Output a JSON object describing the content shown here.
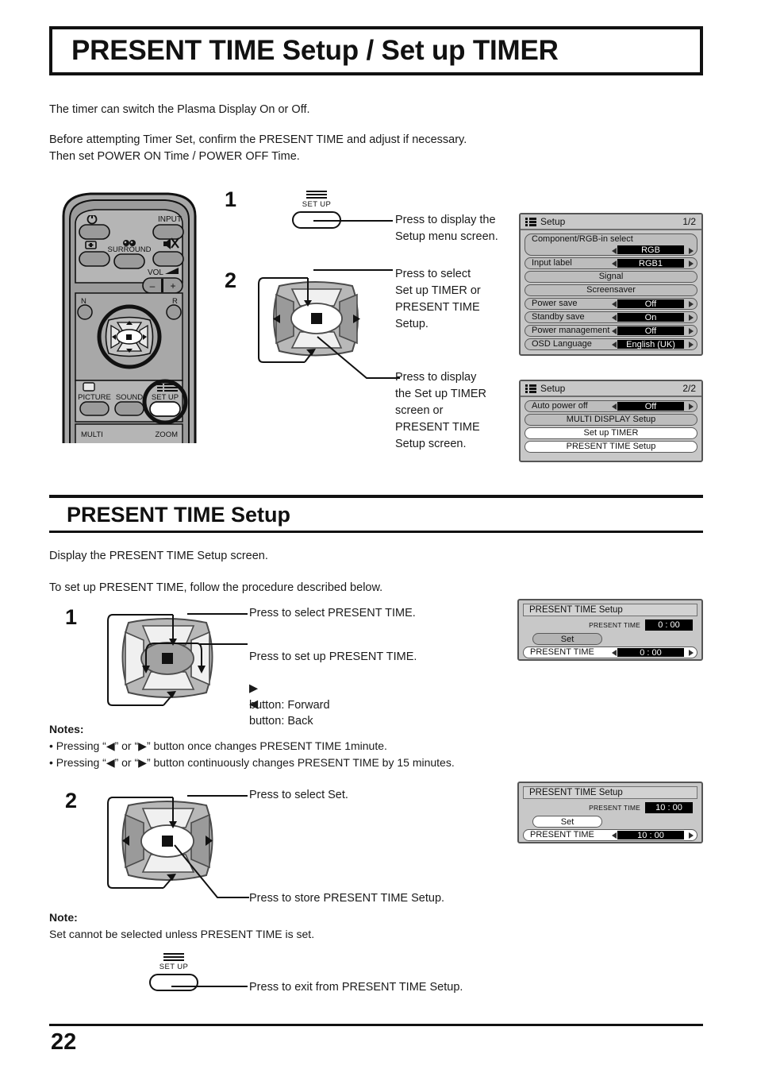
{
  "document": {
    "title": "PRESENT TIME Setup / Set up TIMER",
    "page_number": "22"
  },
  "intro": {
    "line1": "The timer can switch the Plasma Display On or Off.",
    "line2": "Before attempting Timer Set, confirm the PRESENT TIME and adjust if necessary.\nThen set POWER ON Time / POWER OFF Time."
  },
  "steps_top": {
    "step1_number": "1",
    "step2_number": "2",
    "setup_key_label": "SET UP",
    "callout1": "Press to display the\nSetup menu screen.",
    "callout2": "Press to select\nSet up TIMER or\nPRESENT TIME\nSetup.",
    "callout3": "Press to display\nthe Set up TIMER\nscreen or\nPRESENT TIME\nSetup screen."
  },
  "section": {
    "heading": "PRESENT TIME Setup",
    "line1": "Display the PRESENT TIME Setup screen.",
    "line2": "To set up PRESENT TIME, follow the procedure described below."
  },
  "steps_bottom": {
    "step1_number": "1",
    "step2_number": "2",
    "s1_callout_a": "Press to select PRESENT TIME.",
    "s1_callout_b": "Press to set up PRESENT TIME.",
    "s1_forward": "button: Forward",
    "s1_back": "button: Back",
    "s2_callout_a": "Press to select Set.",
    "s2_callout_b": "Press to store PRESENT TIME Setup."
  },
  "notes_block": {
    "heading": "Notes:",
    "item1_pre": "• Pressing “",
    "item1_mid": "” or “",
    "item1_post": "” button once changes PRESENT TIME 1minute.",
    "item2_post": "” button continuously changes PRESENT TIME by 15 minutes."
  },
  "note_block": {
    "heading": "Note:",
    "text": "Set cannot be selected unless PRESENT TIME is set."
  },
  "exit": {
    "setup_key_label": "SET UP",
    "callout": "Press to exit from PRESENT TIME Setup."
  },
  "remote": {
    "labels": {
      "input": "INPUT",
      "surround": "SURROUND",
      "vol": "VOL",
      "n": "N",
      "r": "R",
      "picture": "PICTURE",
      "sound": "SOUND",
      "setup": "SET UP",
      "multi": "MULTI",
      "zoom": "ZOOM",
      "vol_minus": "–",
      "vol_plus": "+"
    },
    "icons": {
      "power": "power-icon",
      "aspect": "aspect-icon",
      "surround": "surround-icon",
      "mute": "mute-icon",
      "vol": "volume-icon",
      "setup": "setup-lines-icon"
    }
  },
  "osd_setup_1": {
    "title": "Setup",
    "page": "1/2",
    "rows": [
      {
        "label": "Component/RGB-in  select",
        "value": "RGB",
        "style": "gray",
        "arrows": true,
        "two_line": true
      },
      {
        "label": "Input label",
        "value": "RGB1",
        "style": "gray",
        "arrows": true,
        "two_line": false
      },
      {
        "label": "Signal",
        "value": "",
        "style": "gray",
        "arrows": false,
        "centered": true
      },
      {
        "label": "Screensaver",
        "value": "",
        "style": "gray",
        "arrows": false,
        "centered": true
      },
      {
        "label": "Power save",
        "value": "Off",
        "style": "gray",
        "arrows": true,
        "two_line": false
      },
      {
        "label": "Standby save",
        "value": "On",
        "style": "gray",
        "arrows": true,
        "two_line": false
      },
      {
        "label": "Power management",
        "value": "Off",
        "style": "gray",
        "arrows": true,
        "two_line": false
      },
      {
        "label": "OSD  Language",
        "value": "English (UK)",
        "style": "gray",
        "arrows": true,
        "two_line": false
      }
    ]
  },
  "osd_setup_2": {
    "title": "Setup",
    "page": "2/2",
    "rows": [
      {
        "label": "Auto power off",
        "value": "Off",
        "style": "gray",
        "arrows": true,
        "centered": false
      },
      {
        "label": "MULTI DISPLAY Setup",
        "value": "",
        "style": "gray",
        "arrows": false,
        "centered": true
      },
      {
        "label": "Set up TIMER",
        "value": "",
        "style": "white",
        "arrows": false,
        "centered": true
      },
      {
        "label": "PRESENT  TIME  Setup",
        "value": "",
        "style": "white",
        "arrows": false,
        "centered": true
      }
    ]
  },
  "osd_present_time_1": {
    "title": "PRESENT TIME Setup",
    "readout_label": "PRESENT TIME",
    "readout_value": "0 : 00",
    "set_label": "Set",
    "set_state": "disabled",
    "row_label": "PRESENT TIME",
    "row_value": "0 : 00"
  },
  "osd_present_time_2": {
    "title": "PRESENT TIME Setup",
    "readout_label": "PRESENT TIME",
    "readout_value": "10 : 00",
    "set_label": "Set",
    "set_state": "selected",
    "row_label": "PRESENT TIME",
    "row_value": "10 : 00"
  },
  "colors": {
    "ink": "#111111",
    "osd_background": "#c8c8c8",
    "osd_row_gray": "#bdbdbd",
    "osd_row_white": "#ffffff",
    "osd_value_field": "#000000",
    "remote_body": "#9e9e9e"
  }
}
